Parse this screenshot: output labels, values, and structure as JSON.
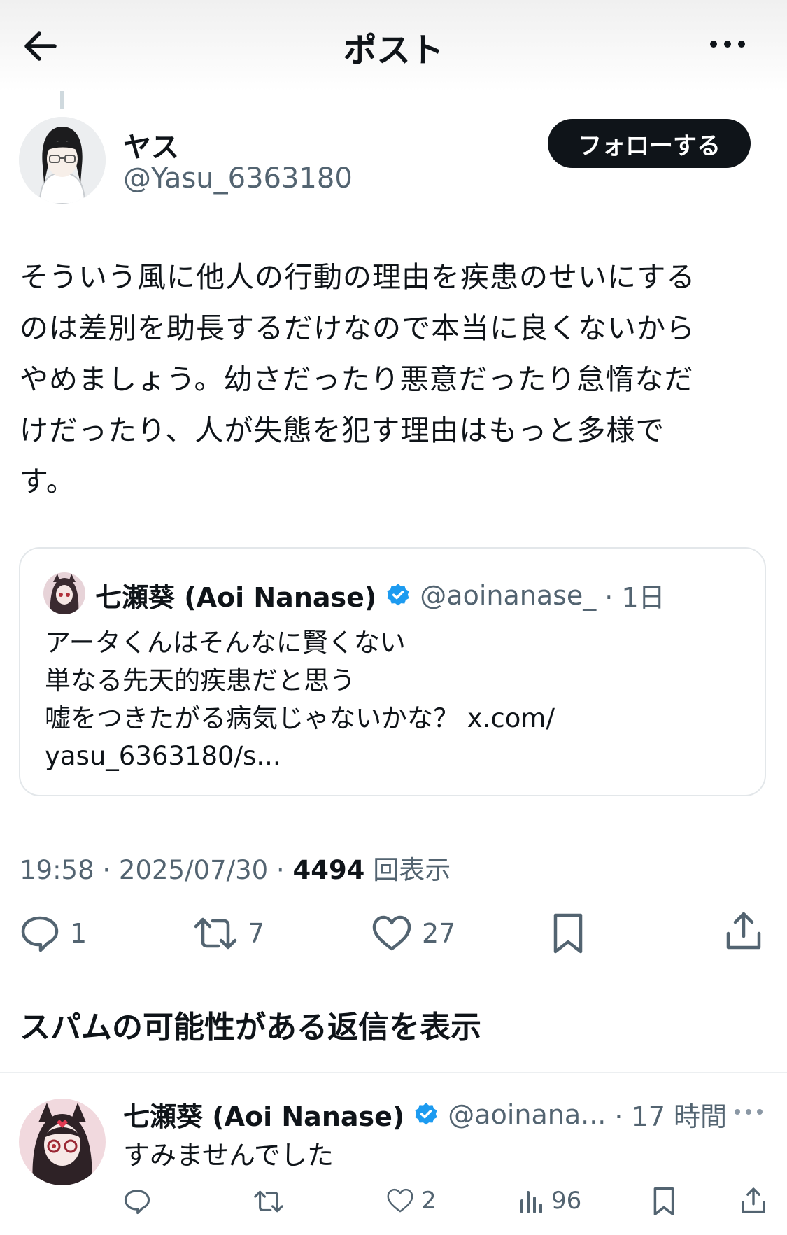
{
  "header": {
    "title": "ポスト"
  },
  "post": {
    "author_name": "ヤス",
    "author_handle": "@Yasu_6363180",
    "follow_label": "フォローする",
    "text": "そういう風に他人の行動の理由を疾患のせいにする\nのは差別を助長するだけなので本当に良くないから\nやめましょう。幼さだったり悪意だったり怠惰なだ\nけだったり、人が失態を犯す理由はもっと多様で\nす。",
    "quote": {
      "author_name": "七瀬葵 (Aoi Nanase)",
      "author_handle": "@aoinanase_",
      "time": "· 1日",
      "text": "アータくんはそんなに賢くない\n単なる先天的疾患だと思う\n嘘をつきたがる病気じゃないかな？ x.com/\nyasu_6363180/s..."
    },
    "timestamp": "19:58 · 2025/07/30 · ",
    "views_count": "4494",
    "views_label": " 回表示",
    "actions": {
      "replies": "1",
      "reposts": "7",
      "likes": "27"
    }
  },
  "spam_replies_label": "スパムの可能性がある返信を表示",
  "reply": {
    "author_name": "七瀬葵 (Aoi Nanase)",
    "author_handle": "@aoinana...",
    "time": "· 17 時間",
    "text": "すみませんでした",
    "actions": {
      "likes": "2",
      "views": "96"
    }
  },
  "colors": {
    "text": "#0f1419",
    "secondary": "#536471",
    "verified": "#1d9bf0",
    "border": "#e3e7ea"
  },
  "icons": [
    "back-arrow-icon",
    "more-icon",
    "verified-badge-icon",
    "reply-icon",
    "repost-icon",
    "like-icon",
    "bookmark-icon",
    "share-icon",
    "views-icon"
  ]
}
